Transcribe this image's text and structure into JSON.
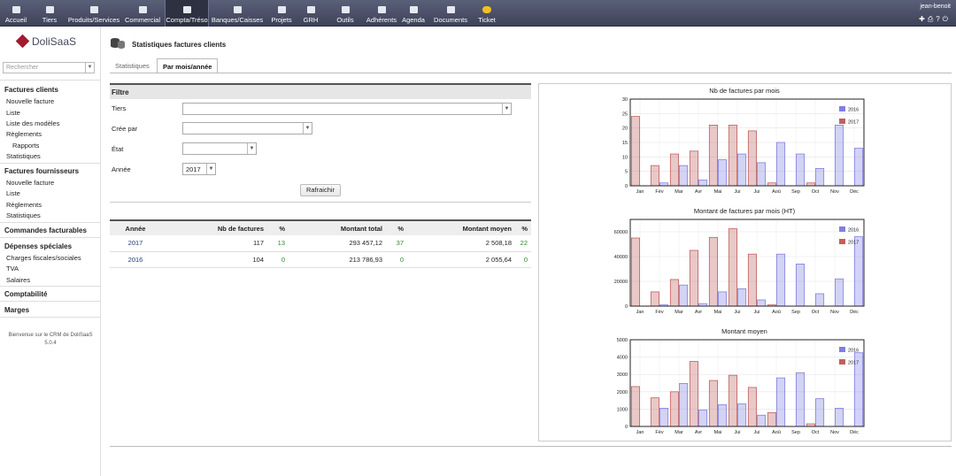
{
  "topmenu": [
    {
      "label": "Accueil",
      "icon": "home-icon"
    },
    {
      "label": "Tiers",
      "icon": "building-icon"
    },
    {
      "label": "Produits/Services",
      "icon": "cube-icon"
    },
    {
      "label": "Commercial",
      "icon": "briefcase-icon"
    },
    {
      "label": "Compta/Tréso",
      "icon": "coins-icon",
      "active": true
    },
    {
      "label": "Banques/Caisses",
      "icon": "bank-icon"
    },
    {
      "label": "Projets",
      "icon": "project-icon"
    },
    {
      "label": "GRH",
      "icon": "hr-icon"
    },
    {
      "label": "Outils",
      "icon": "tools-icon"
    },
    {
      "label": "Adhérents",
      "icon": "members-icon"
    },
    {
      "label": "Agenda",
      "icon": "calendar-icon"
    },
    {
      "label": "Documents",
      "icon": "documents-icon"
    },
    {
      "label": "Ticket",
      "icon": "ticket-icon"
    }
  ],
  "user": {
    "name": "jean-benoit"
  },
  "logo": {
    "text": "DoliSaaS"
  },
  "search": {
    "placeholder": "Rechercher"
  },
  "sidebar": {
    "g1": {
      "title": "Factures clients",
      "items": [
        "Nouvelle facture",
        "Liste",
        "Liste des modèles",
        "Règlements",
        "Rapports",
        "Statistiques"
      ]
    },
    "g2": {
      "title": "Factures fournisseurs",
      "items": [
        "Nouvelle facture",
        "Liste",
        "Règlements",
        "Statistiques"
      ]
    },
    "g3": {
      "title": "Commandes facturables"
    },
    "g4": {
      "title": "Dépenses spéciales",
      "items": [
        "Charges fiscales/sociales",
        "TVA",
        "Salaires"
      ]
    },
    "g5": {
      "title": "Comptabilité"
    },
    "g6": {
      "title": "Marges"
    },
    "footer": [
      "Bienvenue sur le CRM de DoliSaaS",
      "5.0.4"
    ]
  },
  "page": {
    "title": "Statistiques factures clients"
  },
  "tabs": [
    "Statistiques",
    "Par mois/année"
  ],
  "filter": {
    "header": "Filtre",
    "tiers_label": "Tiers",
    "creepar_label": "Crée par",
    "etat_label": "État",
    "annee_label": "Année",
    "annee_value": "2017",
    "refresh": "Rafraichir"
  },
  "table": {
    "headers": [
      "Année",
      "Nb de factures",
      "%",
      "Montant total",
      "%",
      "Montant moyen",
      "%"
    ],
    "rows": [
      [
        "2017",
        "117",
        "13",
        "293 457,12",
        "37",
        "2 508,18",
        "22"
      ],
      [
        "2016",
        "104",
        "0",
        "213 786,93",
        "0",
        "2 055,64",
        "0"
      ]
    ]
  },
  "colors": {
    "s2016": "#8080e0",
    "s2017": "#c06060"
  },
  "chart_data": [
    {
      "type": "bar",
      "title": "Nb de factures par mois",
      "categories": [
        "Jan",
        "Fév",
        "Mar",
        "Avr",
        "Mai",
        "Jui",
        "Jui",
        "Aoû",
        "Sep",
        "Oct",
        "Nov",
        "Déc"
      ],
      "ylim": [
        0,
        30
      ],
      "yticks": [
        0,
        5,
        10,
        15,
        20,
        25,
        30
      ],
      "series": [
        {
          "name": "2016",
          "values": [
            0,
            1,
            7,
            2,
            9,
            11,
            8,
            15,
            11,
            6,
            21,
            13
          ]
        },
        {
          "name": "2017",
          "values": [
            24,
            7,
            11,
            12,
            21,
            21,
            19,
            1,
            0,
            1,
            0,
            0
          ]
        }
      ]
    },
    {
      "type": "bar",
      "title": "Montant de factures par mois (HT)",
      "categories": [
        "Jan",
        "Fév",
        "Mar",
        "Avr",
        "Mai",
        "Jui",
        "Jui",
        "Aoû",
        "Sep",
        "Oct",
        "Nov",
        "Déc"
      ],
      "ylim": [
        0,
        70000
      ],
      "yticks": [
        0,
        20000,
        40000,
        60000
      ],
      "series": [
        {
          "name": "2016",
          "values": [
            0,
            1000,
            17000,
            2000,
            11500,
            14000,
            5000,
            42000,
            34000,
            10000,
            22000,
            56000
          ]
        },
        {
          "name": "2017",
          "values": [
            55000,
            11500,
            21500,
            45000,
            55500,
            62500,
            42000,
            1000,
            0,
            0,
            0,
            0
          ]
        }
      ]
    },
    {
      "type": "bar",
      "title": "Montant moyen",
      "categories": [
        "Jan",
        "Fév",
        "Mar",
        "Avr",
        "Mai",
        "Jui",
        "Jui",
        "Aoû",
        "Sep",
        "Oct",
        "Nov",
        "Déc"
      ],
      "ylim": [
        0,
        5000
      ],
      "yticks": [
        0,
        1000,
        2000,
        3000,
        4000,
        5000
      ],
      "series": [
        {
          "name": "2016",
          "values": [
            0,
            1050,
            2480,
            950,
            1250,
            1300,
            650,
            2800,
            3100,
            1600,
            1050,
            4250
          ]
        },
        {
          "name": "2017",
          "values": [
            2300,
            1650,
            2000,
            3750,
            2650,
            2950,
            2250,
            800,
            0,
            150,
            0,
            0
          ]
        }
      ]
    }
  ]
}
